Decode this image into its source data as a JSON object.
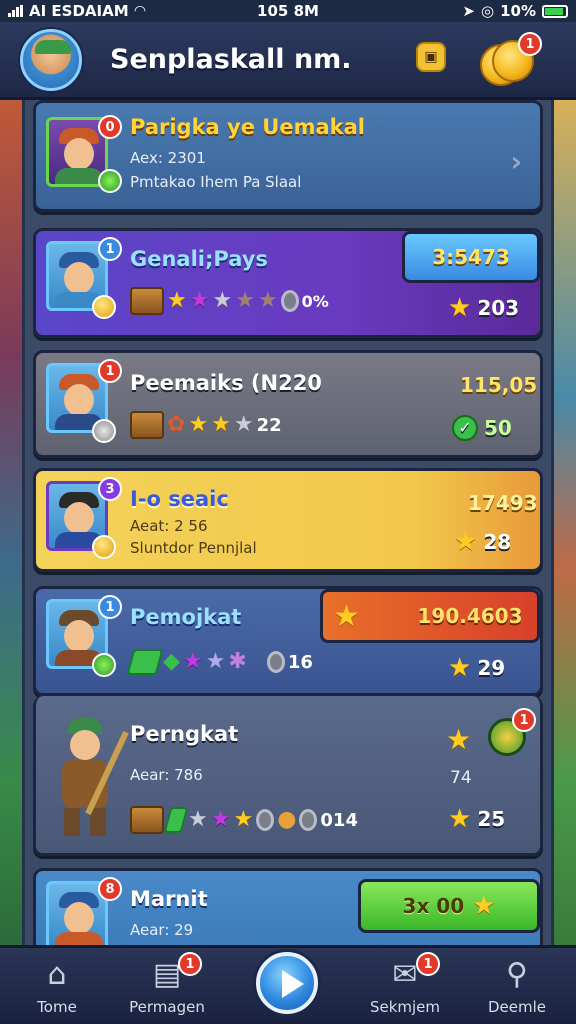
{
  "status_bar": {
    "carrier": "AI ESDAIAM",
    "time": "105 8M",
    "battery_percent": "10%"
  },
  "header": {
    "title": "Senplaskall nm.",
    "coin_badge": "1"
  },
  "cards": [
    {
      "title": "Parigka ye Uemakal",
      "line1": "Aex: 2301",
      "line2": "Pmtakao Ihem Pa Slaal",
      "badge": "0"
    },
    {
      "title": "Genali;Pays",
      "items_suffix": "0%",
      "value": "3:5473",
      "count": "203",
      "badge": "1"
    },
    {
      "title": "Peemaiks (N220",
      "items_count": "22",
      "value": "115,05",
      "count": "50",
      "badge": "1"
    },
    {
      "title": "I-o seaic",
      "line1": "Aeat: 2 56",
      "line2": "Sluntdor Pennjlal",
      "value": "17493",
      "count": "28",
      "badge": "3"
    },
    {
      "title": "Pemojkat",
      "items_count": "16",
      "value": "190.4603",
      "count": "29",
      "badge": "1"
    },
    {
      "title": "Perngkat",
      "line1": "Aear: 786",
      "items_count": "014",
      "value": "74",
      "count": "25",
      "badge": "1"
    },
    {
      "title": "Marnit",
      "line1": "Aear: 29",
      "value": "3x 00",
      "badge": "8"
    }
  ],
  "bottom_nav": [
    {
      "label": "Tome",
      "icon": "home-icon"
    },
    {
      "label": "Permagen",
      "icon": "shop-icon",
      "badge": "1"
    },
    {
      "label": "",
      "icon": "play-icon"
    },
    {
      "label": "Sekmjem",
      "icon": "mail-icon",
      "badge": "1"
    },
    {
      "label": "Deemle",
      "icon": "search-icon"
    }
  ],
  "colors": {
    "header_bg": "#2d3a5e",
    "card_purple": "#6a3ac0",
    "card_yellow": "#f2c84a",
    "card_blue": "#3a78b8",
    "accent_red": "#e23a2a",
    "accent_green": "#3ac04a"
  }
}
